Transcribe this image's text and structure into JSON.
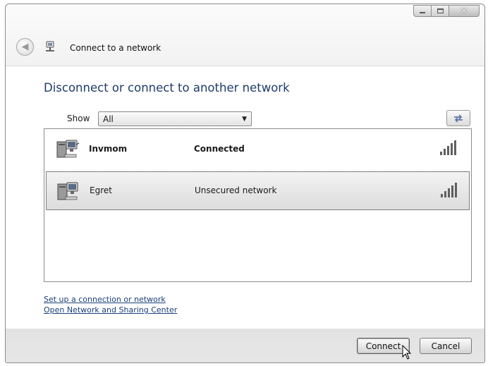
{
  "window": {
    "title": "Connect to a network"
  },
  "header": {
    "heading": "Disconnect or connect to another network"
  },
  "filter": {
    "show_label": "Show",
    "selected": "All"
  },
  "networks": [
    {
      "name": "Invmom",
      "status": "Connected",
      "selected": false,
      "signal_bars": 5
    },
    {
      "name": "Egret",
      "status": "Unsecured network",
      "selected": true,
      "signal_bars": 5
    }
  ],
  "links": {
    "setup": "Set up a connection or network",
    "sharing_center": "Open Network and Sharing Center"
  },
  "buttons": {
    "connect": "Connect",
    "cancel": "Cancel"
  },
  "icons": {
    "back": "back-arrow-icon",
    "network_window": "network-icon",
    "computer": "computer-network-icon",
    "refresh": "refresh-icon",
    "signal": "signal-strength-icon"
  },
  "colors": {
    "heading": "#1e3b6b",
    "link": "#1a3f7a"
  }
}
